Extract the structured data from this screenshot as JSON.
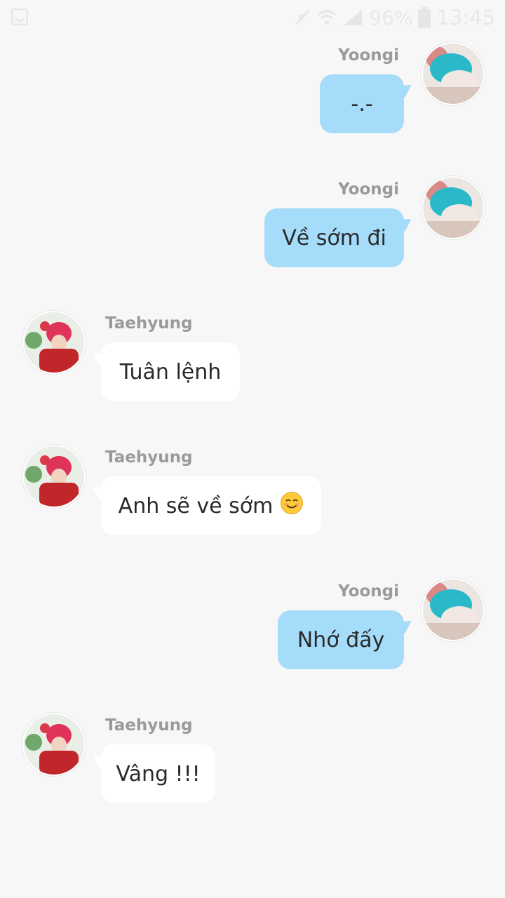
{
  "status_bar": {
    "battery": "96%",
    "time": "13:45",
    "icons": [
      "screenshot-icon",
      "mute-icon",
      "wifi-icon",
      "signal-icon",
      "battery-icon"
    ]
  },
  "messages": [
    {
      "sender": "Yoongi",
      "text": "-.-",
      "side": "right"
    },
    {
      "sender": "Yoongi",
      "text": "Về sớm đi",
      "side": "right"
    },
    {
      "sender": "Taehyung",
      "text": "Tuân lệnh",
      "side": "left"
    },
    {
      "sender": "Taehyung",
      "text": "Anh sẽ về sớm",
      "emoji": "smiling-face-icon",
      "side": "left"
    },
    {
      "sender": "Yoongi",
      "text": "Nhớ đấy",
      "side": "right"
    },
    {
      "sender": "Taehyung",
      "text": "Vâng !!!",
      "side": "left"
    }
  ],
  "colors": {
    "outgoing_bubble": "#a4dcfa",
    "incoming_bubble": "#ffffff",
    "background": "#f7f7f7",
    "name_text": "#9a9a9a"
  }
}
